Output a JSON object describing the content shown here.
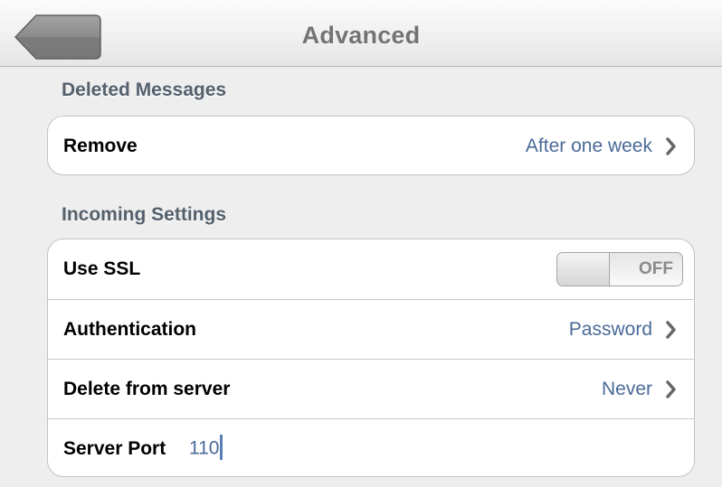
{
  "navbar": {
    "title": "Advanced",
    "back_icon": "back-arrow-icon"
  },
  "sections": {
    "deleted_messages": {
      "header": "Deleted Messages",
      "remove": {
        "label": "Remove",
        "value": "After one week"
      }
    },
    "incoming_settings": {
      "header": "Incoming Settings",
      "use_ssl": {
        "label": "Use SSL",
        "state": "OFF"
      },
      "authentication": {
        "label": "Authentication",
        "value": "Password"
      },
      "delete_from_server": {
        "label": "Delete from server",
        "value": "Never"
      },
      "server_port": {
        "label": "Server Port",
        "value": "110"
      }
    }
  },
  "colors": {
    "value_text": "#4a6a98",
    "background": "#eeeeee",
    "section_header": "#54606c"
  }
}
